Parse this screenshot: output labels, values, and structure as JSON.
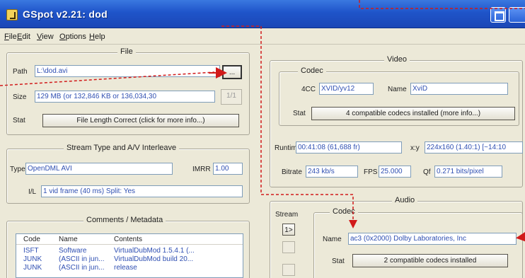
{
  "window": {
    "title": "GSpot v2.21: dod"
  },
  "menu": [
    "File",
    "Edit",
    "View",
    "Options",
    "Help"
  ],
  "file": {
    "legend": "File",
    "path_label": "Path",
    "path_value": "L:\\dod.avi",
    "browse_label": "...",
    "size_label": "Size",
    "size_value": "129 MB (or 132,846 KB or 136,034,30",
    "size_btn": "1/1",
    "stat_label": "Stat",
    "stat_value": "File Length Correct (click for more info...)"
  },
  "stream": {
    "legend": "Stream Type and A/V Interleave",
    "type_label": "Type",
    "type_value": "OpenDML AVI",
    "imrr_label": "IMRR",
    "imrr_value": "1.00",
    "il_label": "I/L",
    "il_value": "1 vid frame (40 ms)  Split: Yes"
  },
  "comments": {
    "legend": "Comments / Metadata",
    "headers": [
      "Code",
      "Name",
      "Contents"
    ],
    "rows": [
      [
        "ISFT",
        "Software",
        "VirtualDubMod 1.5.4.1 (..."
      ],
      [
        "JUNK",
        "(ASCII in jun...",
        "VirtualDubMod build 20..."
      ],
      [
        "JUNK",
        "(ASCII in jun...",
        "release"
      ]
    ]
  },
  "video": {
    "legend": "Video",
    "codec_legend": "Codec",
    "fourcc_label": "4CC",
    "fourcc_value": "XVID/yv12",
    "name_label": "Name",
    "name_value": "XviD",
    "stat_label": "Stat",
    "stat_value": "4 compatible codecs installed (more info...)",
    "runtime_label": "Runtime",
    "runtime_value": "00:41:08 (61,688 fr)",
    "xy_label": "x:y",
    "xy_value": "224x160 (1.40:1) [~14:10",
    "bitrate_label": "Bitrate",
    "bitrate_value": "243 kb/s",
    "fps_label": "FPS",
    "fps_value": "25.000",
    "qf_label": "Qf",
    "qf_value": "0.271 bits/pixel"
  },
  "audio": {
    "legend": "Audio",
    "stream_label": "Stream",
    "stream_btn": "1>",
    "codec_legend": "Codec",
    "name_label": "Name",
    "name_value": "ac3 (0x2000) Dolby Laboratories, Inc",
    "stat_label": "Stat",
    "stat_value": "2 compatible codecs installed"
  },
  "colors": {
    "annotation": "#d11a1a",
    "title_bar": "#1f54c9",
    "value_text": "#2f4fb2"
  }
}
